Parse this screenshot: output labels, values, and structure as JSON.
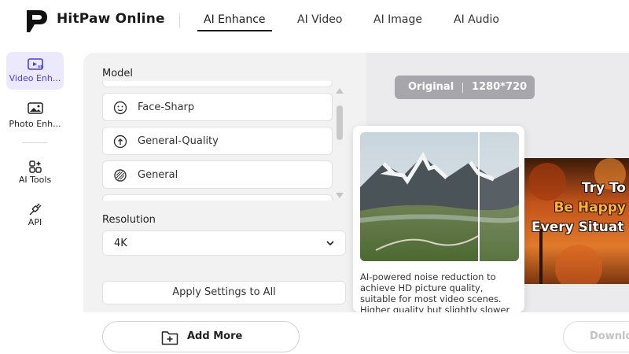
{
  "app": {
    "brand": "HitPaw Online"
  },
  "nav": {
    "tabs": [
      {
        "label": "AI Enhance",
        "active": true
      },
      {
        "label": "AI Video"
      },
      {
        "label": "AI Image"
      },
      {
        "label": "AI Audio"
      }
    ]
  },
  "sidebar": {
    "items": [
      {
        "label": "Video Enh...",
        "icon": "video-hd-icon",
        "active": true
      },
      {
        "label": "Photo Enh...",
        "icon": "photo-hd-icon"
      },
      {
        "label": "AI Tools",
        "icon": "ai-tools-icon"
      },
      {
        "label": "API",
        "icon": "api-plug-icon"
      }
    ]
  },
  "settings": {
    "model_label": "Model",
    "models": [
      {
        "label": "Face-Sharp",
        "icon": "face-sharp-icon"
      },
      {
        "label": "General-Quality",
        "icon": "general-quality-icon"
      },
      {
        "label": "General",
        "icon": "general-icon"
      }
    ],
    "resolution_label": "Resolution",
    "resolution_value": "4K",
    "apply_label": "Apply Settings to All"
  },
  "preview": {
    "badge_original": "Original",
    "badge_resolution": "1280*720",
    "thumbnail_lines": [
      "Try To",
      "Be Happy",
      "Every Situat"
    ]
  },
  "tooltip": {
    "description": "AI-powered noise reduction to achieve HD picture quality, suitable for most video scenes. Higher quality but slightly slower"
  },
  "bottom": {
    "add_more_label": "Add More",
    "download_label": "Downlo"
  },
  "colors": {
    "accent": "#4a3ee8",
    "active_bg": "#ece9fd",
    "panel_bg": "#f2f2f3",
    "badge_bg": "#a7a7ab"
  }
}
